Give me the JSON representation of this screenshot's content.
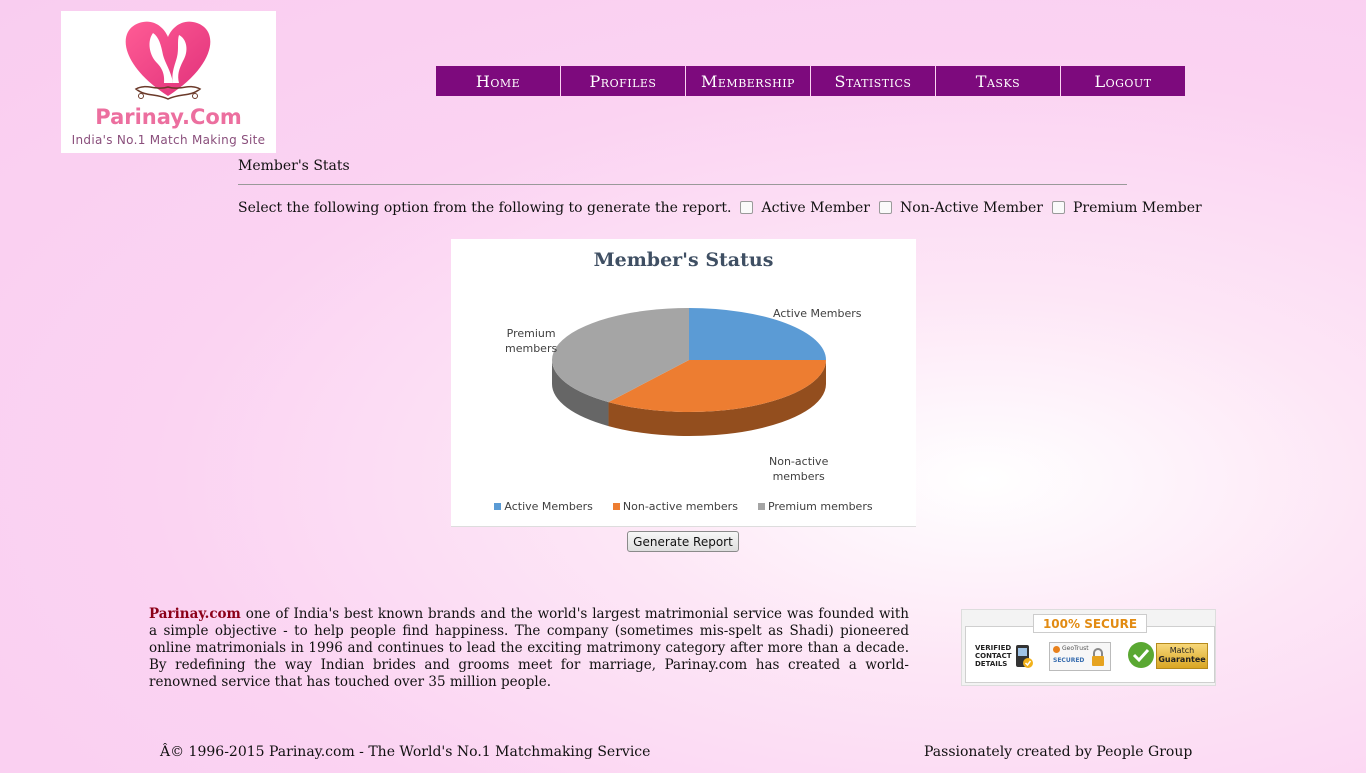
{
  "logo": {
    "name": "Parinay.Com",
    "tagline": "India's No.1 Match Making Site"
  },
  "nav": [
    "Home",
    "Profiles",
    "Membership",
    "Statistics",
    "Tasks",
    "Logout"
  ],
  "page": {
    "section_title": "Member's Stats",
    "options_prompt": "Select the following option from the following to generate the report.",
    "options": [
      {
        "label": "Active Member",
        "checked": false
      },
      {
        "label": "Non-Active Member",
        "checked": false
      },
      {
        "label": "Premium Member",
        "checked": false
      }
    ],
    "generate_button": "Generate Report"
  },
  "chart_data": {
    "type": "pie",
    "title": "Member's Status",
    "categories": [
      "Active Members",
      "Non-active members",
      "Premium members"
    ],
    "values": [
      25,
      35,
      40
    ],
    "colors": [
      "#5b9bd5",
      "#ed7d31",
      "#a5a5a5"
    ],
    "slice_labels": [
      {
        "lines": [
          "Active Members"
        ]
      },
      {
        "lines": [
          "Non-active",
          "members"
        ]
      },
      {
        "lines": [
          "Premium",
          "members"
        ]
      }
    ],
    "legend_position": "bottom",
    "style": "3d"
  },
  "about": {
    "brand": "Parinay.com",
    "text": " one of India's best known brands and the world's largest matrimonial service was founded with a simple objective - to help people find happiness. The company (sometimes mis-spelt as Shadi) pioneered online matrimonials in 1996 and continues to lead the exciting matrimony category after more than a decade. By redefining the way Indian brides and grooms meet for marriage, Parinay.com has created a world-renowned service that has touched over 35 million people."
  },
  "secure_badge": {
    "heading": "100% SECURE",
    "verified_lines": [
      "VERIFIED",
      "CONTACT",
      "DETAILS"
    ],
    "geotrust_brand": "GeoTrust",
    "geotrust_status": "SECURED",
    "guarantee_lines": [
      "Match",
      "Guarantee"
    ]
  },
  "footer": {
    "copyright": "Â© 1996-2015 Parinay.com - The World's No.1 Matchmaking Service",
    "credit": "Passionately created by People Group"
  }
}
